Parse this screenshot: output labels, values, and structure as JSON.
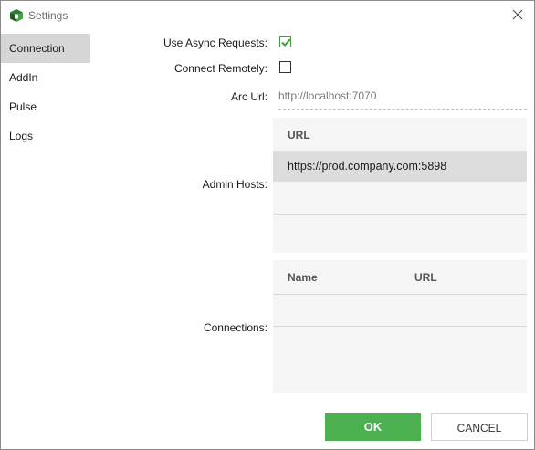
{
  "window": {
    "title": "Settings"
  },
  "sidebar": {
    "items": [
      {
        "label": "Connection",
        "active": true
      },
      {
        "label": "AddIn",
        "active": false
      },
      {
        "label": "Pulse",
        "active": false
      },
      {
        "label": "Logs",
        "active": false
      }
    ]
  },
  "form": {
    "use_async_label": "Use Async Requests:",
    "use_async_checked": true,
    "connect_remotely_label": "Connect Remotely:",
    "connect_remotely_checked": false,
    "arc_url_label": "Arc Url:",
    "arc_url_placeholder": "http://localhost:7070",
    "admin_hosts_label": "Admin Hosts:",
    "connections_label": "Connections:"
  },
  "admin_hosts": {
    "header": "URL",
    "rows": [
      {
        "url": "https://prod.company.com:5898",
        "selected": true
      }
    ]
  },
  "connections": {
    "headers": {
      "name": "Name",
      "url": "URL"
    },
    "rows": []
  },
  "footer": {
    "ok_label": "OK",
    "cancel_label": "CANCEL"
  },
  "colors": {
    "accent": "#4caf50",
    "selected_row": "#dcdcdc",
    "sidebar_active": "#d6d6d6"
  }
}
